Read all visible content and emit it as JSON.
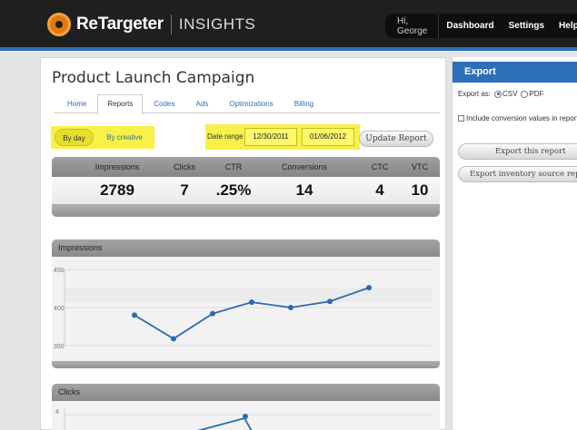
{
  "brand": {
    "name": "ReTargeter",
    "product": "INSIGHTS"
  },
  "topnav": {
    "greeting": "Hi, George",
    "links": [
      "Dashboard",
      "Settings",
      "Help"
    ]
  },
  "page": {
    "title": "Product Launch Campaign"
  },
  "tabs": [
    "Home",
    "Reports",
    "Codes",
    "Ads",
    "Optimizations",
    "Billing"
  ],
  "active_tab": "Reports",
  "view_toggle": {
    "by_day": "By day",
    "by_creative": "By creative",
    "selected": "By day"
  },
  "date_range": {
    "label": "Date range",
    "start": "12/30/2011",
    "end": "01/06/2012",
    "update_label": "Update Report"
  },
  "stats": [
    {
      "label": "Impressions",
      "value": "2789"
    },
    {
      "label": "Clicks",
      "value": "7"
    },
    {
      "label": "CTR",
      "value": ".25%"
    },
    {
      "label": "Conversions",
      "value": "14"
    },
    {
      "label": "CTC",
      "value": "4"
    },
    {
      "label": "VTC",
      "value": "10"
    }
  ],
  "impressions_chart": {
    "title": "Impressions",
    "chart_data": {
      "type": "line",
      "title": "Impressions",
      "y_ticks": [
        "450",
        "400",
        "350"
      ],
      "ylim": [
        350,
        450
      ],
      "values": [
        390,
        359,
        392,
        407,
        400,
        408,
        426
      ],
      "color": "#2d6ab5"
    }
  },
  "clicks_chart": {
    "title": "Clicks",
    "chart_data": {
      "type": "line",
      "title": "Clicks",
      "y_ticks": [
        "4"
      ],
      "visible_point": 4,
      "color": "#2d6ab5"
    }
  },
  "export": {
    "title": "Export",
    "export_as_label": "Export as:",
    "formats": [
      "CSV",
      "PDF"
    ],
    "selected_format": "CSV",
    "include_conversion_label": "Include conversion values in report",
    "export_report_label": "Export this report",
    "export_inventory_label": "Export inventory source report"
  }
}
